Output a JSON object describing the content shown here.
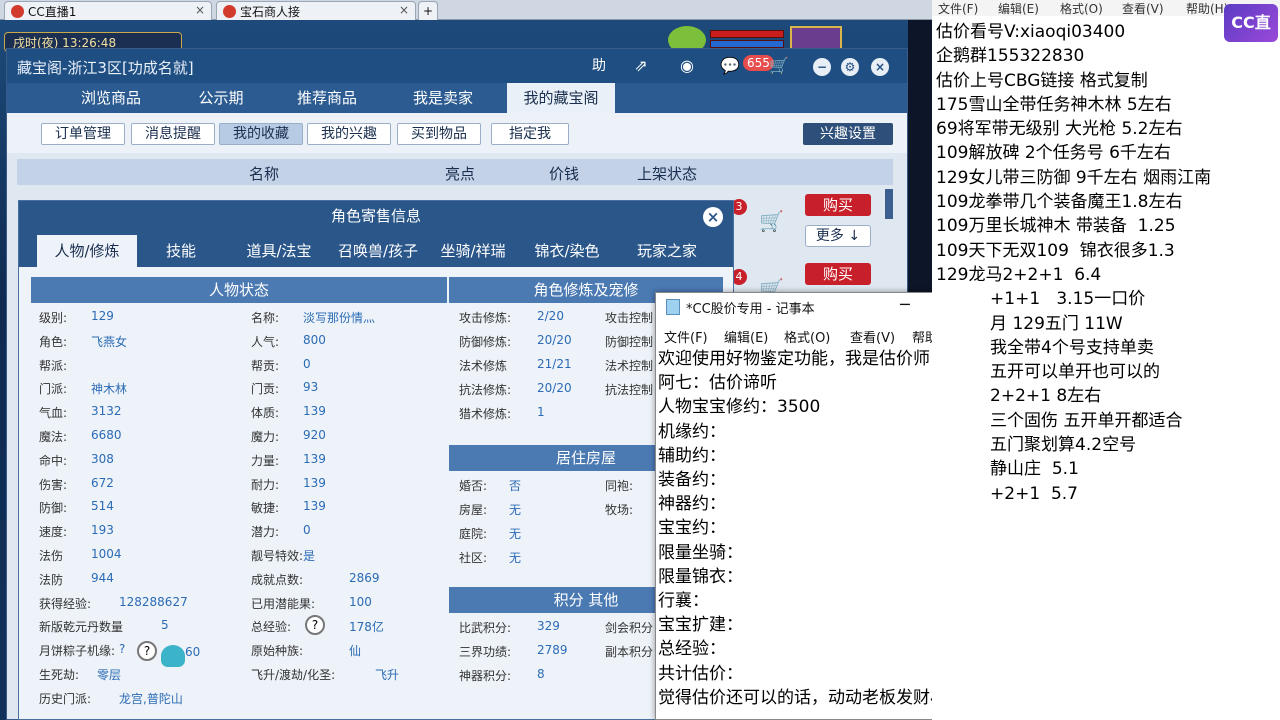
{
  "browser": {
    "tabs": [
      {
        "label": "CC直播1",
        "close": "×"
      },
      {
        "label": "宝石商人接",
        "close": "×"
      }
    ],
    "new_tab": "+"
  },
  "game": {
    "time_text": "戌时(夜) 13:26:48"
  },
  "cbg": {
    "title": "藏宝阁-浙江3区[功成名就]",
    "help": "助",
    "badge": "655",
    "nav": [
      "浏览商品",
      "公示期",
      "推荐商品",
      "我是卖家",
      "我的藏宝阁"
    ],
    "search_placeholder": "",
    "sub": [
      "订单管理",
      "消息提醒",
      "我的收藏",
      "我的兴趣",
      "买到物品",
      "指定我"
    ],
    "interest": "兴趣设置",
    "columns": [
      "名称",
      "亮点",
      "价钱",
      "上架状态"
    ],
    "buy": "购买",
    "more": "更多 ↓",
    "row_badges": [
      "3",
      "4"
    ]
  },
  "role": {
    "title": "角色寄售信息",
    "close": "×",
    "tabs": [
      "人物/修炼",
      "技能",
      "道具/法宝",
      "召唤兽/孩子",
      "坐骑/祥瑞",
      "锦衣/染色",
      "玩家之家"
    ],
    "status_head": "人物状态",
    "left": [
      {
        "k": "级别:",
        "v": "129"
      },
      {
        "k": "角色:",
        "v": "飞燕女"
      },
      {
        "k": "帮派:",
        "v": ""
      },
      {
        "k": "门派:",
        "v": "神木林"
      },
      {
        "k": "气血:",
        "v": "3132"
      },
      {
        "k": "魔法:",
        "v": "6680"
      },
      {
        "k": "命中:",
        "v": "308"
      },
      {
        "k": "伤害:",
        "v": "672"
      },
      {
        "k": "防御:",
        "v": "514"
      },
      {
        "k": "速度:",
        "v": "193"
      },
      {
        "k": "法伤",
        "v": "1004"
      },
      {
        "k": "法防",
        "v": "944"
      },
      {
        "k": "获得经验:",
        "v": "128288627"
      },
      {
        "k": "新版乾元丹数量",
        "v": "5"
      },
      {
        "k": "月饼粽子机缘:",
        "v": "?"
      },
      {
        "k": "生死劫:",
        "v": "零层"
      },
      {
        "k": "历史门派:",
        "v": "龙宫,普陀山"
      }
    ],
    "mid": [
      {
        "k": "名称:",
        "v": "淡写那份情灬"
      },
      {
        "k": "人气:",
        "v": "800"
      },
      {
        "k": "帮贡:",
        "v": "0"
      },
      {
        "k": "门贡:",
        "v": "93"
      },
      {
        "k": "体质:",
        "v": "139"
      },
      {
        "k": "魔力:",
        "v": "920"
      },
      {
        "k": "力量:",
        "v": "139"
      },
      {
        "k": "耐力:",
        "v": "139"
      },
      {
        "k": "敏捷:",
        "v": "139"
      },
      {
        "k": "潜力:",
        "v": "0"
      },
      {
        "k": "靓号特效:",
        "v": "是"
      },
      {
        "k": "成就点数:",
        "v": "2869"
      },
      {
        "k": "已用潜能果:",
        "v": "100"
      },
      {
        "k": "总经验:",
        "v": "178亿"
      },
      {
        "k": "原始种族:",
        "v": "仙"
      },
      {
        "k": "飞升/渡劫/化圣:",
        "v": "飞升"
      }
    ],
    "yuebing_tail": "60",
    "xiulian_head": "角色修炼及宠修",
    "xiulian": [
      {
        "k": "攻击修炼:",
        "v": "2/20",
        "k2": "攻击控制"
      },
      {
        "k": "防御修炼:",
        "v": "20/20",
        "k2": "防御控制"
      },
      {
        "k": "法术修炼",
        "v": "21/21",
        "k2": "法术控制"
      },
      {
        "k": "抗法修炼:",
        "v": "20/20",
        "k2": "抗法控制"
      },
      {
        "k": "猎术修炼:",
        "v": "1",
        "k2": ""
      }
    ],
    "house_head": "居住房屋",
    "house": [
      {
        "k": "婚否:",
        "v": "否",
        "k2": "同袍:"
      },
      {
        "k": "房屋:",
        "v": "无",
        "k2": "牧场:"
      },
      {
        "k": "庭院:",
        "v": "无",
        "k2": ""
      },
      {
        "k": "社区:",
        "v": "无",
        "k2": ""
      }
    ],
    "score_head": "积分 其他",
    "score": [
      {
        "k": "比武积分:",
        "v": "329",
        "k2": "剑会积分"
      },
      {
        "k": "三界功绩:",
        "v": "2789",
        "k2": "副本积分"
      },
      {
        "k": "神器积分:",
        "v": "8",
        "k2": ""
      }
    ]
  },
  "notepad": {
    "title": "*CC股价专用 - 记事本",
    "menu": [
      "文件(F)",
      "编辑(E)",
      "格式(O)",
      "查看(V)",
      "帮助(H)"
    ],
    "lines": [
      "欢迎使用好物鉴定功能，我是估价师",
      "阿七：估价谛听",
      "人物宝宝修约：3500",
      "机缘约：",
      "辅助约：",
      "装备约：",
      "神器约：",
      "宝宝约：",
      "限量坐骑：",
      "限量锦衣：",
      "行襄：",
      "宝宝扩建：",
      "总经验：",
      "共计估价：",
      "觉得估价还可以的话，动动老板发财小手给"
    ]
  },
  "right": {
    "menu": [
      "文件(F)",
      "编辑(E)",
      "格式(O)",
      "查看(V)",
      "帮助(H)"
    ],
    "logo": "CC直播",
    "lines": [
      "估价看号V:xiaoqi03400",
      "企鹅群155322830",
      "估价上号CBG链接 格式复制",
      "175雪山全带任务神木林 5左右",
      "69将军带无级别 大光枪 5.2左右",
      "109解放碑 2个任务号 6千左右",
      "129女儿带三防御 9千左右 烟雨江南",
      "109龙拳带几个装备魔王1.8左右",
      "109万里长城神木 带装备  1.25",
      "109天下无双109  锦衣很多1.3",
      "129龙马2+2+1  6.4",
      "          +1+1   3.15一口价",
      "          月 129五门 11W",
      "          我全带4个号支持单卖",
      "          五开可以单开也可以的",
      "          2+2+1 8左右",
      "          三个固伤 五开单开都适合",
      "          五门聚划算4.2空号",
      "          静山庄  5.1",
      "          +2+1  5.7"
    ]
  }
}
